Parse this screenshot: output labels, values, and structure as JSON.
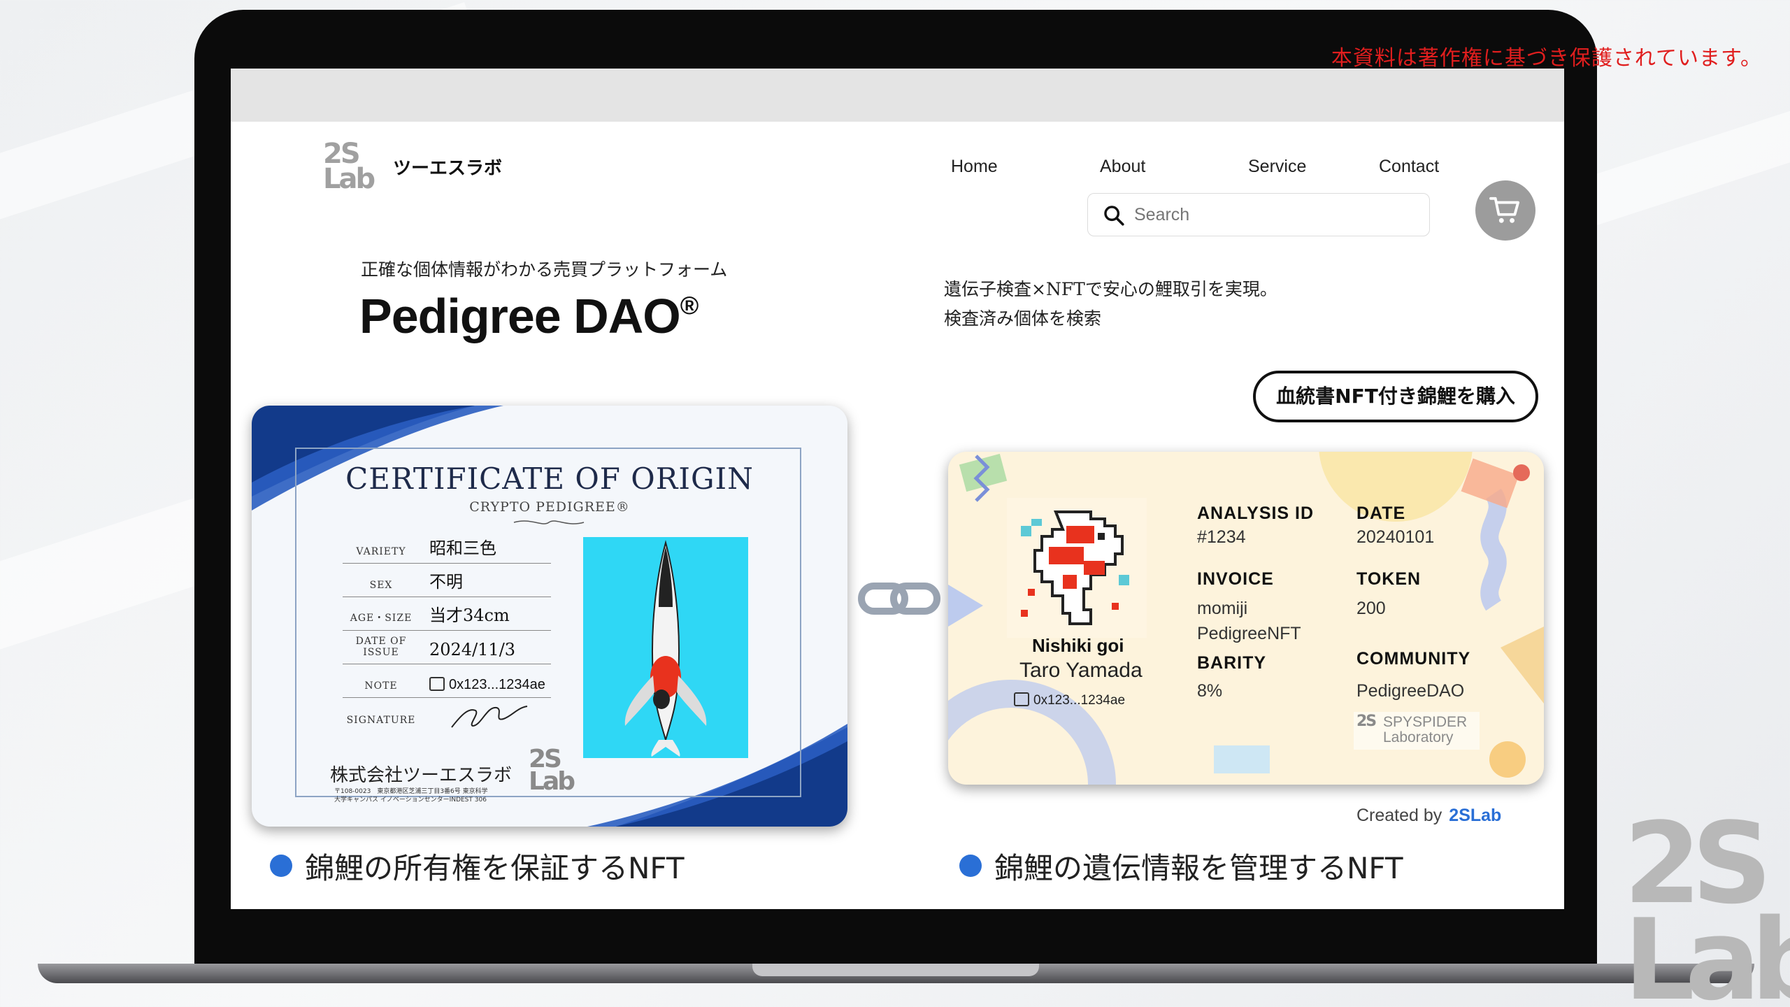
{
  "copyright_notice": "本資料は著作権に基づき保護されています。",
  "brand": {
    "logo_text_top": "2S",
    "logo_text_bottom": "Lab",
    "name": "ツーエスラボ"
  },
  "nav": {
    "items": [
      "Home",
      "About",
      "Service",
      "Contact"
    ]
  },
  "search": {
    "placeholder": "Search"
  },
  "hero": {
    "tagline": "正確な個体情報がわかる売買プラットフォーム",
    "title": "Pedigree DAO",
    "title_mark": "®",
    "description_lines": [
      "遺伝子検査×NFTで安心の鯉取引を実現。",
      "検査済み個体を検索"
    ],
    "buy_button": "血統書NFT付き錦鯉を購入"
  },
  "certificate": {
    "title": "CERTIFICATE OF ORIGIN",
    "subtitle": "CRYPTO PEDIGREE®",
    "rows": [
      {
        "label": "VARIETY",
        "value": "昭和三色"
      },
      {
        "label": "SEX",
        "value": "不明"
      },
      {
        "label": "AGE・SIZE",
        "value": "当才34cm"
      },
      {
        "label": "DATE OF ISSUE",
        "value": "2024/11/3"
      },
      {
        "label": "NOTE",
        "value": "0x123...1234ae"
      },
      {
        "label": "SIGNATURE",
        "value": ""
      }
    ],
    "company": "株式会社ツーエスラボ",
    "address_lines": [
      "〒108-0023　東京都港区芝浦三丁目3番6号 東京科学",
      "大学キャンパス イノベーションセンターINDEST 306"
    ],
    "logo_top": "2S",
    "logo_bottom": "Lab"
  },
  "nft": {
    "name": "Nishiki goi",
    "owner": "Taro Yamada",
    "wallet": "0x123...1234ae",
    "fields": {
      "analysis_id": {
        "label": "ANALYSIS ID",
        "value": "#1234"
      },
      "date": {
        "label": "DATE",
        "value": "20240101"
      },
      "invoice": {
        "label": "INVOICE",
        "value_line1": "momiji",
        "value_line2": "PedigreeNFT"
      },
      "token": {
        "label": "TOKEN",
        "value": "200"
      },
      "barity": {
        "label": "BARITY",
        "value": "8%"
      },
      "community": {
        "label": "COMMUNITY",
        "value": "PedigreeDAO"
      }
    },
    "partner_mark": "2S",
    "partner_line1": "SPYSPIDER",
    "partner_line2": "Laboratory"
  },
  "credits": {
    "created_by": "Created by",
    "brand": "2SLab"
  },
  "captions": {
    "left": "錦鯉の所有権を保証するNFT",
    "right": "錦鯉の遺伝情報を管理するNFT"
  },
  "watermark": {
    "top": "2S",
    "bottom": "Lab"
  },
  "colors": {
    "accent_blue": "#2a6fd6",
    "copyright_red": "#e01e1e",
    "cert_photo_bg": "#2fd7f5",
    "nft_card_bg": "#fdf3dc"
  }
}
